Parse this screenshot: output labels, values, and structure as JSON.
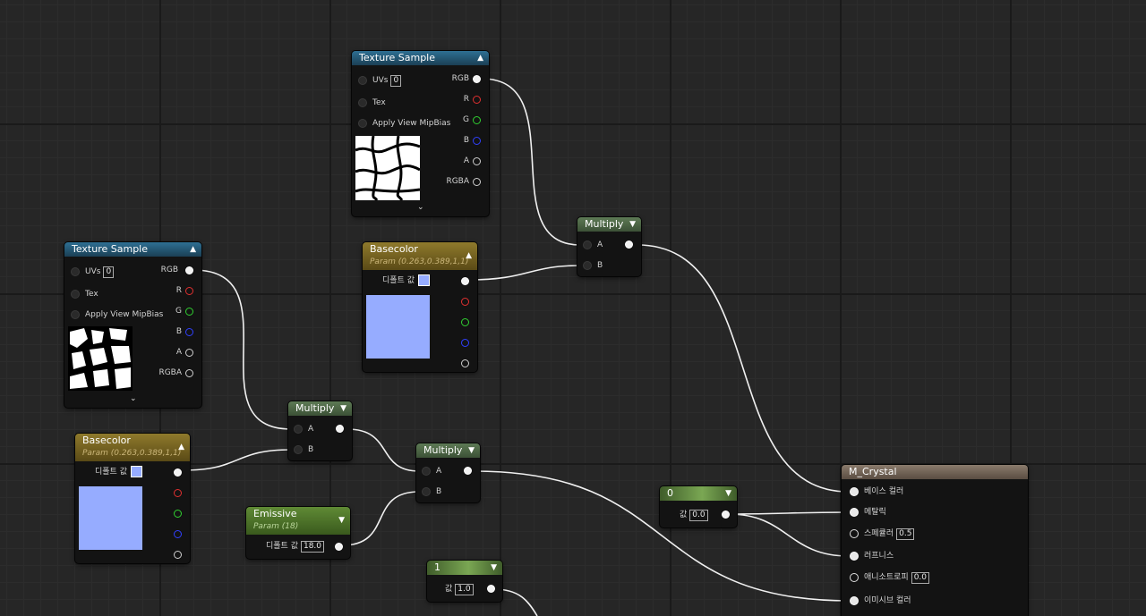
{
  "tex1": {
    "title": "Texture Sample",
    "uvs_label": "UVs",
    "uvs_value": "0",
    "tex_label": "Tex",
    "mip_label": "Apply View MipBias",
    "out_rgb": "RGB",
    "out_r": "R",
    "out_g": "G",
    "out_b": "B",
    "out_a": "A",
    "out_rgba": "RGBA"
  },
  "tex2": {
    "title": "Texture Sample",
    "uvs_label": "UVs",
    "uvs_value": "0",
    "tex_label": "Tex",
    "mip_label": "Apply View MipBias",
    "out_rgb": "RGB",
    "out_r": "R",
    "out_g": "G",
    "out_b": "B",
    "out_a": "A",
    "out_rgba": "RGBA"
  },
  "base1": {
    "title": "Basecolor",
    "subtitle": "Param (0.263,0.389,1,1)",
    "default_label": "디폴트 값",
    "color": "#96acff"
  },
  "base2": {
    "title": "Basecolor",
    "subtitle": "Param (0.263,0.389,1,1)",
    "default_label": "디폴트 값",
    "color": "#96acff"
  },
  "mul1": {
    "title": "Multiply",
    "in_a": "A",
    "in_b": "B"
  },
  "mul2": {
    "title": "Multiply",
    "in_a": "A",
    "in_b": "B"
  },
  "mul3": {
    "title": "Multiply",
    "in_a": "A",
    "in_b": "B"
  },
  "emissive": {
    "title": "Emissive",
    "subtitle": "Param (18)",
    "default_label": "디폴트 값",
    "value": "18.0"
  },
  "const0": {
    "title": "0",
    "value_label": "값",
    "value": "0.0"
  },
  "const1": {
    "title": "1",
    "value_label": "값",
    "value": "1.0"
  },
  "material": {
    "title": "M_Crystal",
    "inputs": [
      {
        "label": "베이스 컬러"
      },
      {
        "label": "메탈릭"
      },
      {
        "label": "스페큘러",
        "value": "0.5"
      },
      {
        "label": "러프니스"
      },
      {
        "label": "애니소트로피",
        "value": "0.0"
      },
      {
        "label": "이미시브 컬러"
      }
    ]
  },
  "icons": {
    "collapse": "chevron-up-icon",
    "expand": "chevron-down-icon"
  }
}
